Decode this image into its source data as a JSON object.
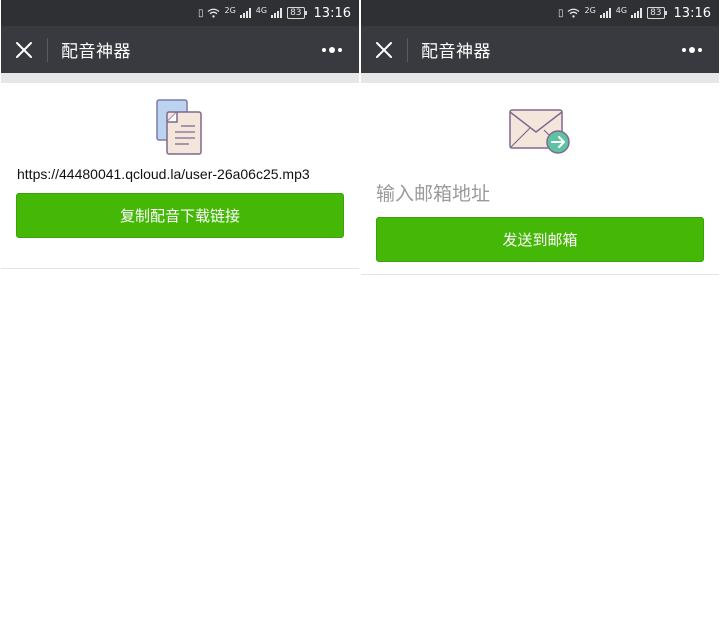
{
  "status_bar": {
    "net_label_1": "2G",
    "net_label_2": "4G",
    "battery": "83",
    "time": "13:16"
  },
  "left_screen": {
    "title": "配音神器",
    "icon": "documents-icon",
    "url": "https://44480041.qcloud.la/user-26a06c25.mp3",
    "button_label": "复制配音下载链接"
  },
  "right_screen": {
    "title": "配音神器",
    "icon": "envelope-send-icon",
    "email_placeholder": "输入邮箱地址",
    "email_value": "",
    "button_label": "发送到邮箱"
  },
  "colors": {
    "status_bar_bg": "#2f3034",
    "navbar_bg": "#393a3f",
    "button_green": "#44b707",
    "placeholder_gray": "#9a9a9a"
  }
}
